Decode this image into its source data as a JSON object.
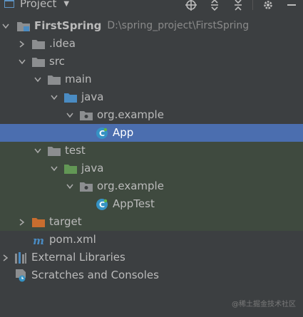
{
  "header": {
    "title": "Project",
    "tools": [
      "locate-icon",
      "expand-all-icon",
      "collapse-all-icon",
      "settings-icon",
      "hide-icon"
    ]
  },
  "tree": {
    "root": {
      "label": "FirstSpring",
      "path": "D:\\spring_project\\FirstSpring"
    },
    "idea": "idea",
    "src": "src",
    "main": "main",
    "main_java": "java",
    "main_pkg": "org.example",
    "app": "App",
    "test": "test",
    "test_java": "java",
    "test_pkg": "org.example",
    "apptest": "AppTest",
    "target": "target",
    "pom": "pom.xml",
    "external": "External Libraries",
    "scratches": "Scratches and Consoles"
  },
  "colors": {
    "selection": "#4b6eaf",
    "folder": "#8c8e90",
    "source_folder": "#4a8bc2",
    "test_folder": "#629755",
    "target_folder": "#c86d2f"
  },
  "watermark": "@稀土掘金技术社区"
}
